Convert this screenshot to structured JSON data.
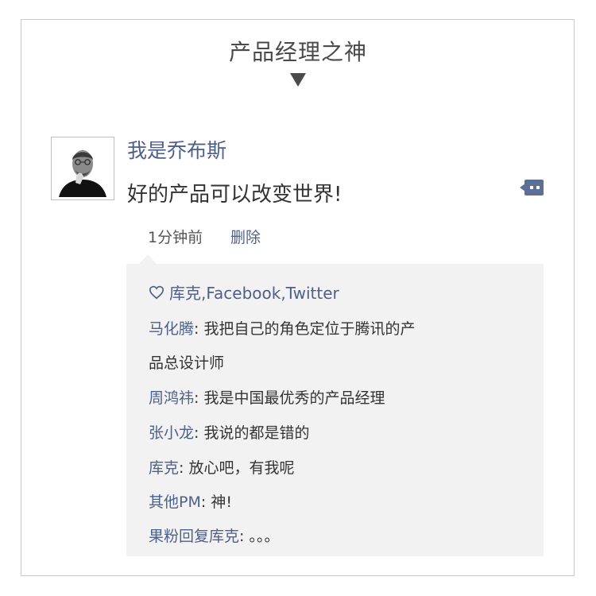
{
  "header": {
    "title": "产品经理之神"
  },
  "post": {
    "username": "我是乔布斯",
    "text": "好的产品可以改变世界!",
    "time": "1分钟前",
    "delete_label": "删除"
  },
  "likes": {
    "icon": "heart-icon",
    "text": "库克,Facebook,Twitter"
  },
  "comments": [
    {
      "name": "马化腾",
      "sep": ": ",
      "text": "我把自己的角色定位于腾讯的产"
    },
    {
      "name": "",
      "sep": "",
      "text": "品总设计师"
    },
    {
      "name": "周鸿祎",
      "sep": ": ",
      "text": "我是中国最优秀的产品经理"
    },
    {
      "name": "张小龙",
      "sep": ": ",
      "text": "我说的都是错的"
    },
    {
      "name": "库克",
      "sep": ": ",
      "text": "放心吧，有我呢"
    },
    {
      "name": "其他PM",
      "sep": ": ",
      "text": "神!"
    },
    {
      "name": "果粉回复库克",
      "sep": ": ",
      "text": "。。。"
    }
  ],
  "colors": {
    "accent": "#4d5f8a",
    "text": "#333333",
    "panel": "#f2f2f2"
  }
}
